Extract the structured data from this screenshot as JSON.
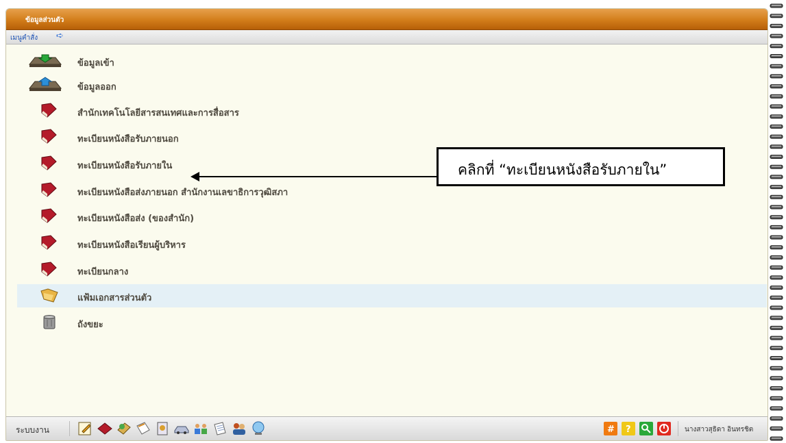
{
  "window": {
    "title": "ข้อมูลส่วนตัว"
  },
  "menubar": {
    "label": "เมนูคำสั่ง"
  },
  "items": [
    {
      "label": "ข้อมูลเข้า",
      "icon": "inbox-tray-icon"
    },
    {
      "label": "ข้อมูลออก",
      "icon": "outbox-tray-icon"
    },
    {
      "label": "สำนักเทคโนโลยีสารสนเทศและการสื่อสาร",
      "icon": "red-book-icon"
    },
    {
      "label": "ทะเบียนหนังสือรับภายนอก",
      "icon": "red-book-icon"
    },
    {
      "label": "ทะเบียนหนังสือรับภายใน",
      "icon": "red-book-icon"
    },
    {
      "label": "ทะเบียนหนังสือส่งภายนอก สำนักงานเลขาธิการวุฒิสภา",
      "icon": "red-book-icon"
    },
    {
      "label": "ทะเบียนหนังสือส่ง (ของสำนัก)",
      "icon": "red-book-icon"
    },
    {
      "label": "ทะเบียนหนังสือเรียนผู้บริหาร",
      "icon": "red-book-icon"
    },
    {
      "label": "ทะเบียนกลาง",
      "icon": "red-book-icon"
    },
    {
      "label": "แฟ้มเอกสารส่วนตัว",
      "icon": "folder-icon",
      "highlighted": true
    },
    {
      "label": "ถังขยะ",
      "icon": "trash-bin-icon"
    }
  ],
  "callout": {
    "text": "คลิกที่ “ทะเบียนหนังสือรับภายใน”"
  },
  "toolbar": {
    "system_label": "ระบบงาน",
    "user_name": "นางสาวสุธิดา อินทรชิต"
  }
}
